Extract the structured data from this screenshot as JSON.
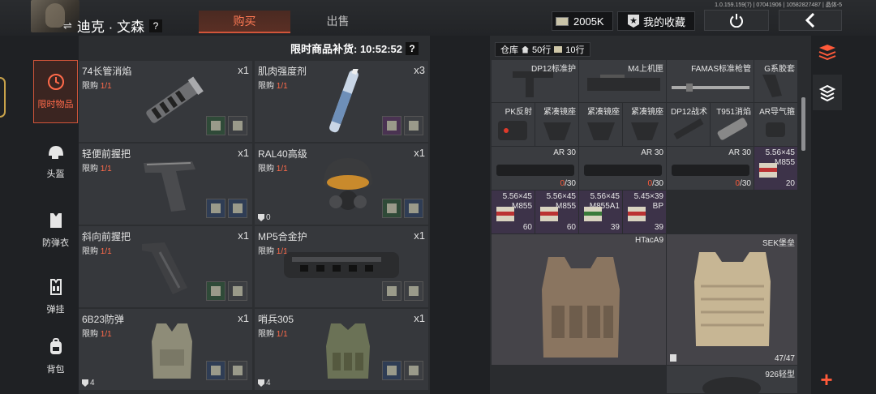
{
  "header": {
    "player_name": "迪克 · 文森",
    "help": "?",
    "tab_buy": "购买",
    "tab_sell": "出售",
    "version": "1.0.159.159(7) | 07041906 | 10582827487 | 晶体-5",
    "money": "2005K",
    "favorites_label": "我的收藏"
  },
  "categories": [
    {
      "label": "限时物品",
      "icon": "clock-icon",
      "active": true
    },
    {
      "label": "头盔",
      "icon": "helmet-icon",
      "active": false
    },
    {
      "label": "防弹衣",
      "icon": "vest-icon",
      "active": false
    },
    {
      "label": "弹挂",
      "icon": "rig-icon",
      "active": false
    },
    {
      "label": "背包",
      "icon": "backpack-icon",
      "active": false
    }
  ],
  "shop": {
    "restock_label": "限时商品补货: 10:52:52",
    "help": "?",
    "items": [
      {
        "name": "74长管消焰",
        "limit_label": "限购",
        "limit": "1/1",
        "qty": "x1",
        "armor": "",
        "costs": [
          "green",
          "gray"
        ]
      },
      {
        "name": "肌肉强度剂",
        "limit_label": "限购",
        "limit": "1/1",
        "qty": "x3",
        "armor": "",
        "costs": [
          "purple",
          "gray"
        ]
      },
      {
        "name": "轻便前握把",
        "limit_label": "限购",
        "limit": "1/1",
        "qty": "x1",
        "armor": "",
        "costs": [
          "blue",
          "blue"
        ]
      },
      {
        "name": "RAL40高级",
        "limit_label": "限购",
        "limit": "1/1",
        "qty": "x1",
        "armor": "0",
        "costs": [
          "green",
          "blue"
        ]
      },
      {
        "name": "斜向前握把",
        "limit_label": "限购",
        "limit": "1/1",
        "qty": "x1",
        "armor": "",
        "costs": [
          "green",
          "gray"
        ]
      },
      {
        "name": "MP5合金护",
        "limit_label": "限购",
        "limit": "1/1",
        "qty": "x1",
        "armor": "",
        "costs": [
          "gray",
          "gray"
        ]
      },
      {
        "name": "6B23防弹",
        "limit_label": "限购",
        "limit": "1/1",
        "qty": "x1",
        "armor": "4",
        "costs": [
          "blue",
          "gray"
        ]
      },
      {
        "name": "哨兵305",
        "limit_label": "限购",
        "limit": "1/1",
        "qty": "x1",
        "armor": "4",
        "costs": [
          "blue",
          "blue"
        ]
      }
    ]
  },
  "warehouse": {
    "title": "仓库",
    "rows_home": "50行",
    "rows_money": "10行",
    "row1": [
      "DP12标准护",
      "M4上机匣",
      "FAMAS标准枪管",
      "G系胶套"
    ],
    "row2": [
      "PK反射",
      "紧凑镜座",
      "紧凑镜座",
      "紧凑镜座",
      "DP12战术",
      "T951消焰",
      "AR导气箍"
    ],
    "row3": [
      {
        "name": "AR 30",
        "count": "0",
        "cap": "/30"
      },
      {
        "name": "AR 30",
        "count": "0",
        "cap": "/30"
      },
      {
        "name": "AR 30",
        "count": "0",
        "cap": "/30"
      },
      {
        "name": "5.56×45",
        "sub": "M855",
        "count": "20"
      }
    ],
    "row4": [
      {
        "name": "5.56×45",
        "sub": "M855",
        "count": "60"
      },
      {
        "name": "5.56×45",
        "sub": "M855",
        "count": "60"
      },
      {
        "name": "5.56×45",
        "sub": "M855A1",
        "count": "39"
      },
      {
        "name": "5.45×39",
        "sub": "BP",
        "count": "39"
      }
    ],
    "armor1": "HTacA9",
    "armor2": "SEK堡垒",
    "armor2_durability": "47/47",
    "bag": "926轻型"
  },
  "colors": {
    "accent": "#ff6a4a",
    "active_bg": "#3b2521",
    "panel": "#2c2e31"
  }
}
